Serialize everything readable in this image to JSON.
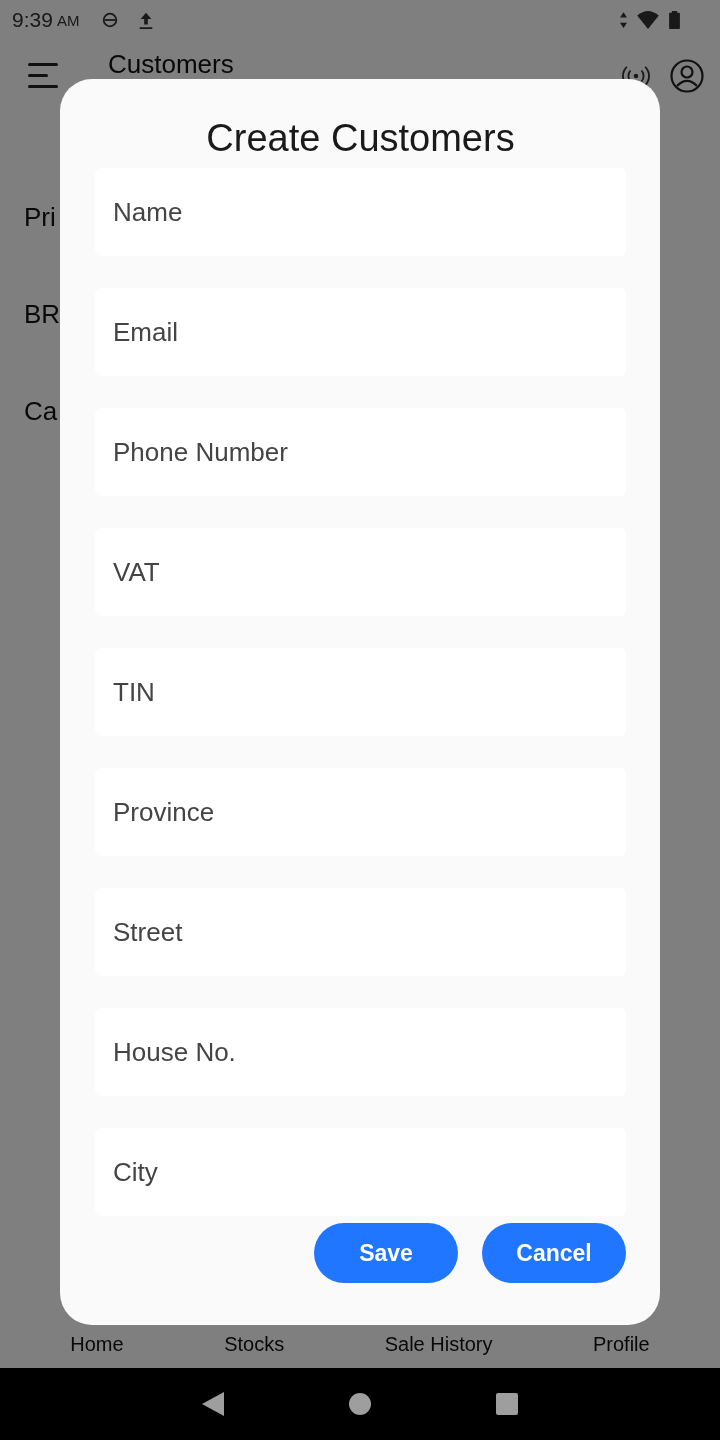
{
  "status_bar": {
    "time": "9:39",
    "meridiem": "AM"
  },
  "app_bar": {
    "title": "Customers"
  },
  "background_items": [
    "Pri",
    "BR",
    "Ca"
  ],
  "dialog": {
    "title": "Create Customers",
    "fields": [
      {
        "placeholder": "Name"
      },
      {
        "placeholder": "Email"
      },
      {
        "placeholder": "Phone Number"
      },
      {
        "placeholder": "VAT"
      },
      {
        "placeholder": "TIN"
      },
      {
        "placeholder": "Province"
      },
      {
        "placeholder": "Street"
      },
      {
        "placeholder": "House No."
      },
      {
        "placeholder": "City"
      }
    ],
    "buttons": [
      "Save",
      "Cancel"
    ]
  },
  "bottom_nav": [
    "Home",
    "Stocks",
    "Sale History",
    "Profile"
  ]
}
